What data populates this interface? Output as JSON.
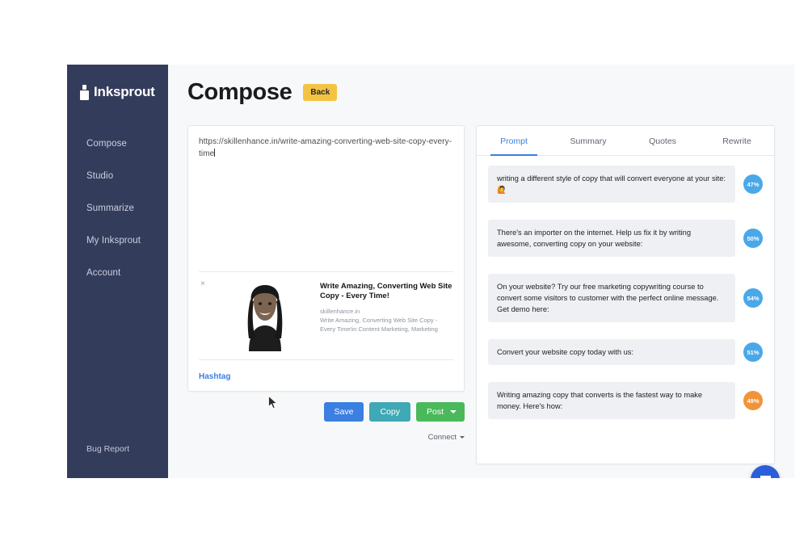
{
  "sidebar": {
    "logo": {
      "icon": "ink-bottle-icon",
      "text": "Inksprout"
    },
    "items": [
      {
        "label": "Compose"
      },
      {
        "label": "Studio"
      },
      {
        "label": "Summarize"
      },
      {
        "label": "My Inksprout"
      },
      {
        "label": "Account"
      }
    ],
    "bug_report": "Bug Report"
  },
  "header": {
    "title": "Compose",
    "back_label": "Back"
  },
  "composer": {
    "text": "https://skillenhance.in/write-amazing-converting-web-site-copy-every-time",
    "close_icon": "×",
    "preview": {
      "title": "Write Amazing, Converting Web Site Copy - Every Time!",
      "domain": "skillenhance.in",
      "description": "Write Amazing, Converting Web Site Copy - Every Time!in Content Marketing, Marketing",
      "image_alt": "woman-portrait-photo"
    },
    "hashtag_label": "Hashtag",
    "buttons": {
      "save": "Save",
      "copy": "Copy",
      "post": "Post"
    },
    "connect_label": "Connect"
  },
  "right_panel": {
    "tabs": [
      {
        "label": "Prompt",
        "active": true
      },
      {
        "label": "Summary",
        "active": false
      },
      {
        "label": "Quotes",
        "active": false
      },
      {
        "label": "Rewrite",
        "active": false
      }
    ],
    "prompts": [
      {
        "text": "writing a different style of copy that will convert everyone at your site: 🙋",
        "score": "47%",
        "score_color": "#4aa8e8"
      },
      {
        "text": "There's an importer on the internet. Help us fix it by writing awesome, converting copy on your website:",
        "score": "50%",
        "score_color": "#4aa8e8"
      },
      {
        "text": "On your website? Try our free marketing copywriting course to convert some visitors to customer with the perfect online message. Get demo here:",
        "score": "54%",
        "score_color": "#4aa8e8"
      },
      {
        "text": "Convert your website copy today with us:",
        "score": "51%",
        "score_color": "#4aa8e8"
      },
      {
        "text": "Writing amazing copy that converts is the fastest way to make money. Here's how:",
        "score": "49%",
        "score_color": "#f0943c"
      }
    ]
  },
  "chat_widget": {
    "icon": "chat-bubble-icon"
  },
  "colors": {
    "sidebar_bg": "#343c5c",
    "accent_blue": "#3b7fe0",
    "back_yellow": "#f5c343",
    "copy_teal": "#3fa9b5",
    "post_green": "#49b95a",
    "chat_blue": "#2b5fd9"
  }
}
